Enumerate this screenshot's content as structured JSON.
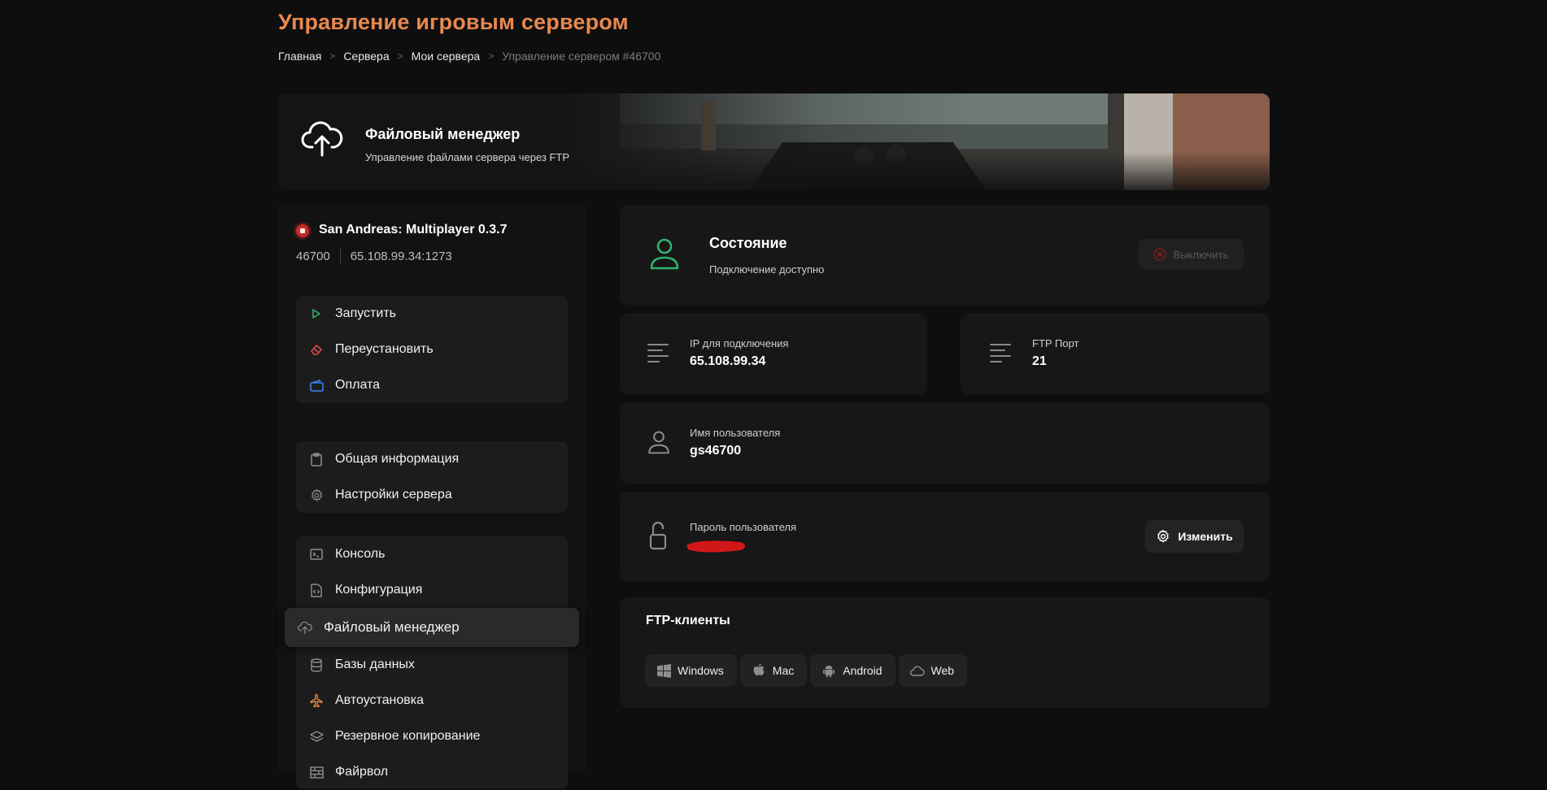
{
  "page": {
    "title": "Управление игровым сервером"
  },
  "breadcrumb": {
    "items": [
      "Главная",
      "Сервера",
      "Мои сервера"
    ],
    "current": "Управление сервером #46700",
    "separator": ">"
  },
  "banner": {
    "icon": "cloud-upload-icon",
    "title": "Файловый менеджер",
    "subtitle": "Управление файлами сервера через FTP"
  },
  "server": {
    "status_color": "#c92a2a",
    "name": "San Andreas: Multiplayer 0.3.7",
    "id": "46700",
    "address": "65.108.99.34:1273"
  },
  "sidebar": {
    "group1": [
      {
        "label": "Запустить",
        "icon": "play-icon",
        "color": "#2fb36e"
      },
      {
        "label": "Переустановить",
        "icon": "eraser-icon",
        "color": "#e0454b"
      },
      {
        "label": "Оплата",
        "icon": "wallet-icon",
        "color": "#3b82f6"
      }
    ],
    "group2": [
      {
        "label": "Общая информация",
        "icon": "clipboard-icon"
      },
      {
        "label": "Настройки сервера",
        "icon": "gear-icon"
      }
    ],
    "group3": [
      {
        "label": "Консоль",
        "icon": "terminal-icon"
      },
      {
        "label": "Конфигурация",
        "icon": "code-file-icon"
      },
      {
        "label": "Файловый менеджер",
        "icon": "cloud-upload-icon",
        "active": true
      },
      {
        "label": "Базы данных",
        "icon": "database-icon"
      },
      {
        "label": "Автоустановка",
        "icon": "plane-icon",
        "color": "#e8884f"
      },
      {
        "label": "Резервное копирование",
        "icon": "layers-icon"
      },
      {
        "label": "Файрвол",
        "icon": "wall-icon"
      }
    ]
  },
  "status_card": {
    "icon": "user-icon",
    "icon_color": "#2fb36e",
    "title": "Состояние",
    "subtitle": "Подключение доступно",
    "button_label": "Выключить"
  },
  "ip_card": {
    "icon": "lines-icon",
    "label": "IP для подключения",
    "value": "65.108.99.34"
  },
  "port_card": {
    "icon": "lines-icon",
    "label": "FTP Порт",
    "value": "21"
  },
  "user_card": {
    "icon": "user-icon",
    "label": "Имя пользователя",
    "value": "gs46700"
  },
  "password_card": {
    "icon": "lock-icon",
    "label": "Пароль пользователя",
    "redaction_color": "#d11717",
    "button_label": "Изменить"
  },
  "clients_card": {
    "title": "FTP-клиенты",
    "clients": [
      {
        "label": "Windows",
        "icon": "windows-icon"
      },
      {
        "label": "Mac",
        "icon": "apple-icon"
      },
      {
        "label": "Android",
        "icon": "android-icon"
      },
      {
        "label": "Web",
        "icon": "cloud-icon"
      }
    ]
  }
}
